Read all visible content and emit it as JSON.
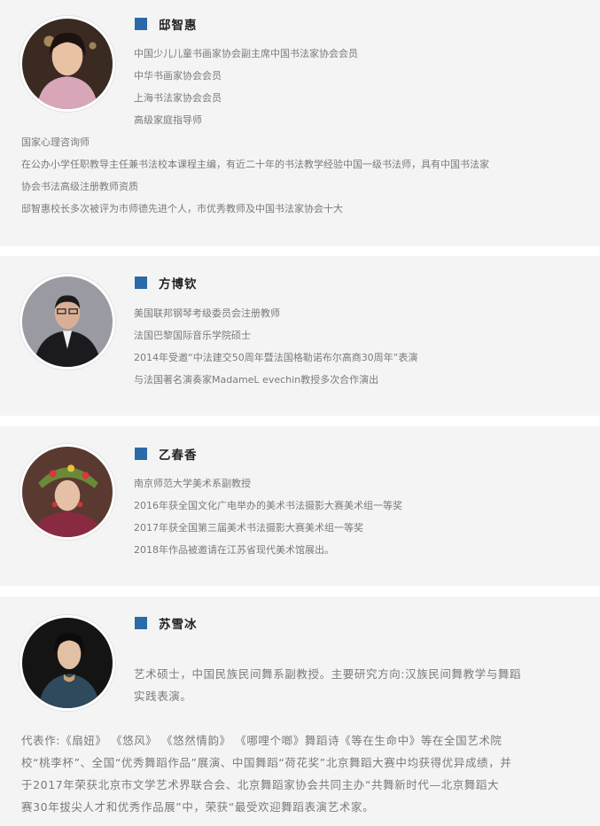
{
  "members": [
    {
      "name": "邸智惠",
      "lines": [
        "中国少儿儿童书画家协会副主席中国书法家协会会员",
        "中华书画家协会会员",
        "上海书法家协会会员",
        "高级家庭指导师",
        "国家心理咨询师",
        "在公办小学任职教导主任兼书法校本课程主编，有近二十年的书法教学经验中国一级书法师，具有中国书法家",
        "协会书法高级注册教师资质",
        "邸智惠校长多次被评为市师德先进个人，市优秀教师及中国书法家协会十大"
      ]
    },
    {
      "name": "方博钦",
      "lines": [
        "美国联邦钢琴考级委员会注册教师",
        "法国巴黎国际音乐学院硕士",
        "2014年受邀“中法建交50周年暨法国格勒诺布尔高商30周年”表演",
        "与法国著名演奏家MadameL evechin教授多次合作演出"
      ]
    },
    {
      "name": "乙春香",
      "lines": [
        "南京师范大学美术系副教授",
        "2016年获全国文化广电举办的美术书法摄影大赛美术组一等奖",
        "2017年获全国第三届美术书法摄影大赛美术组一等奖",
        "2018年作品被邀请在江苏省现代美术馆展出。"
      ]
    },
    {
      "name": "苏雪冰",
      "lines": [
        "艺术硕士，中国民族民间舞系副教授。主要研究方向:汉族民间舞教学与舞蹈",
        "实践表演。",
        "代表作:《扇妞》 《悠风》 《悠然情韵》 《哪哩个啷》舞蹈诗《等在生命中》等在全国艺术院",
        "校“桃李杯”、全国“优秀舞蹈作品”展演、中国舞蹈“荷花奖”北京舞蹈大赛中均获得优异成绩，并",
        "于2017年荣获北京市文学艺术界联合会、北京舞蹈家协会共同主办“共舞新时代—北京舞蹈大",
        "赛30年拔尖人才和优秀作品展”中，荣获“最受欢迎舞蹈表演艺术家。"
      ]
    }
  ],
  "colors": {
    "accent_square": "#2a6aa8",
    "card_bg": "#f4f4f4",
    "text": "#7a7a7a",
    "name": "#222222"
  }
}
